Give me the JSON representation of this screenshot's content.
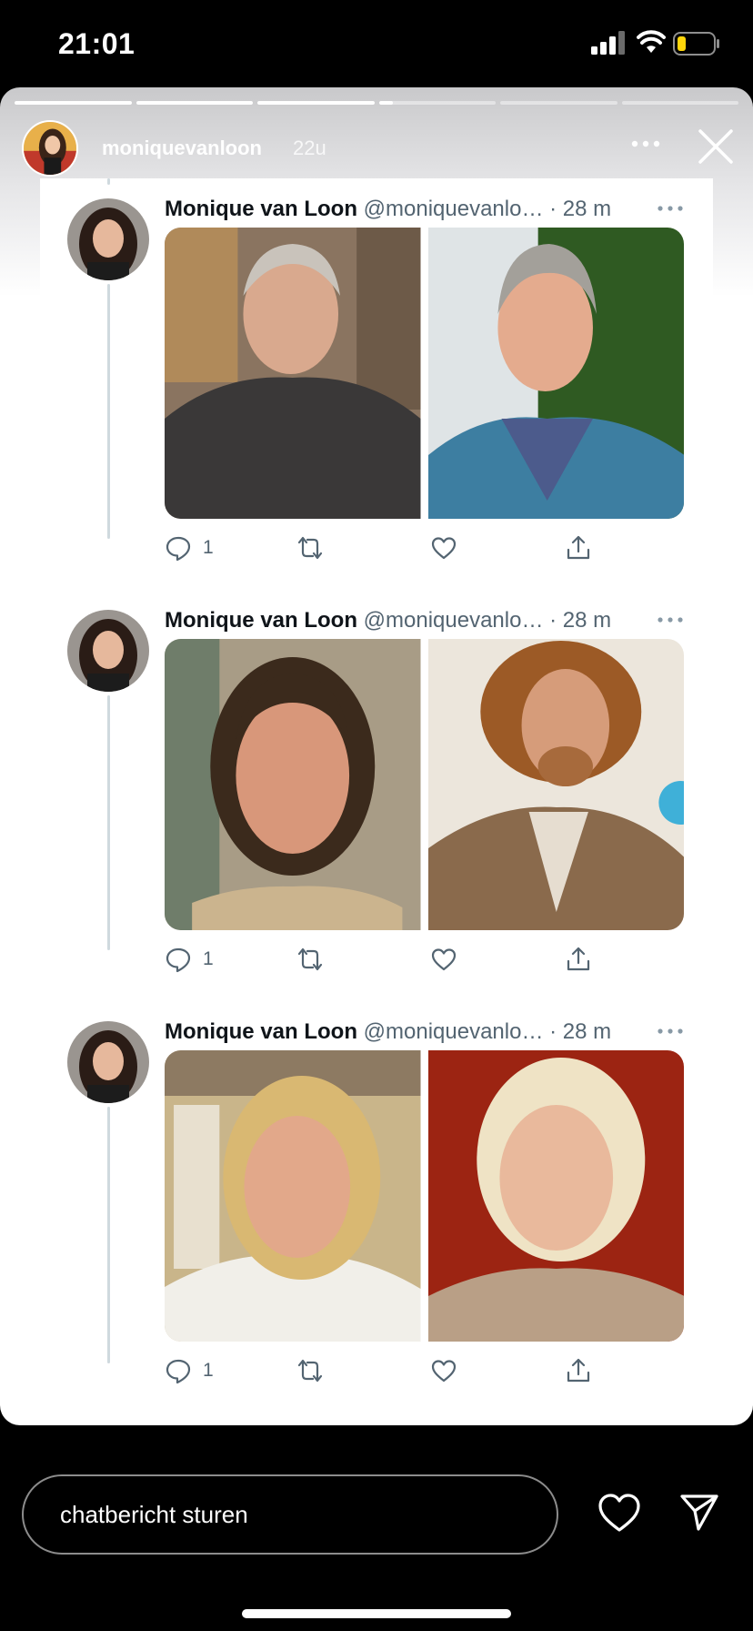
{
  "status_bar": {
    "time": "21:01",
    "icons": [
      "signal-icon",
      "wifi-icon",
      "battery-icon"
    ],
    "battery_color": "#ffd60a"
  },
  "story": {
    "username": "moniquevanloon",
    "age": "22u",
    "segments_total": 6,
    "segments_completed": 3,
    "current_segment_progress": 0.12,
    "icons": [
      "more-icon",
      "close-icon"
    ]
  },
  "tweets": [
    {
      "name": "Monique van Loon",
      "meta": " @moniquevanlo… · 28 m",
      "reply_count": "1",
      "photos": [
        "photo-man-grey-hair-dark-shirt",
        "photo-man-smiling-checked-shirt"
      ]
    },
    {
      "name": "Monique van Loon",
      "meta": " @moniquevanlo… · 28 m",
      "reply_count": "1",
      "photos": [
        "photo-man-long-hair-smiling",
        "photo-man-curly-red-hair"
      ]
    },
    {
      "name": "Monique van Loon",
      "meta": " @moniquevanlo… · 28 m",
      "reply_count": "1",
      "photos": [
        "photo-woman-blonde-white-shirt",
        "photo-woman-blonde-red-background"
      ]
    }
  ],
  "bottom_bar": {
    "placeholder": "chatbericht sturen",
    "icons": [
      "heart-icon",
      "send-icon"
    ]
  },
  "colors": {
    "thread_line": "#cfd9de",
    "secondary_text": "#536471",
    "primary_text": "#0f1419"
  }
}
